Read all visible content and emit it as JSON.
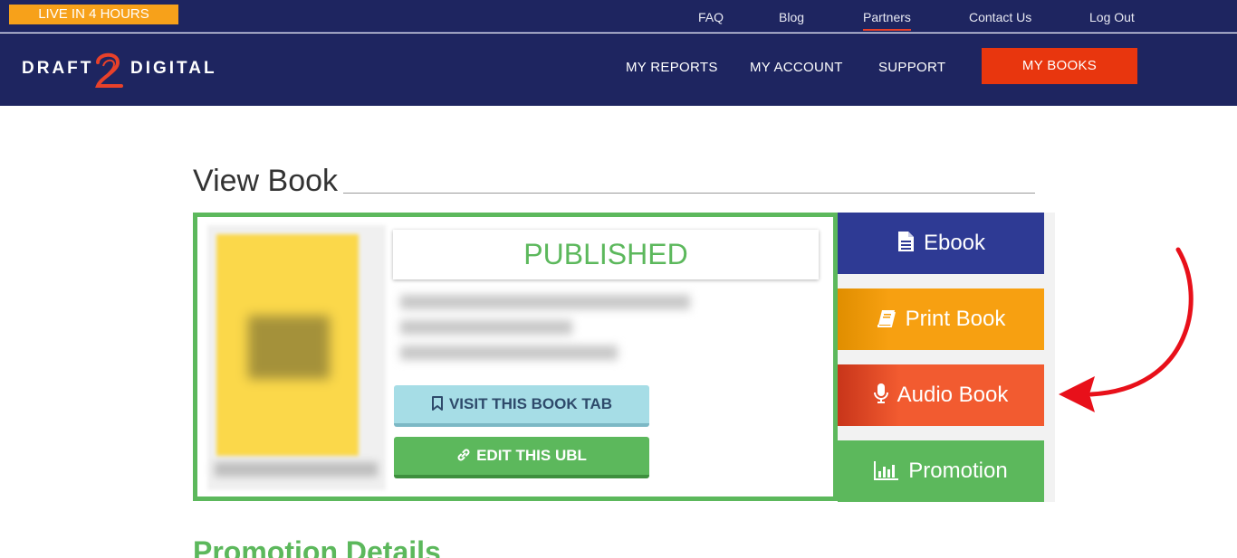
{
  "topbar": {
    "live_badge": "LIVE IN 4 HOURS",
    "links": [
      "FAQ",
      "Blog",
      "Partners",
      "Contact Us",
      "Log Out"
    ],
    "active_link": "Partners",
    "accent_color": "#e8412a"
  },
  "nav": {
    "logo": {
      "left": "DRAFT",
      "right": "DIGITAL",
      "numeral": "2"
    },
    "links": [
      "MY REPORTS",
      "MY ACCOUNT",
      "SUPPORT"
    ],
    "cta_label": "MY BOOKS",
    "cta_color": "#e8360e",
    "background": "#1e2560"
  },
  "page": {
    "title": "View Book",
    "section_heading": "Promotion Details"
  },
  "book": {
    "status": "PUBLISHED",
    "status_color": "#5cb85c",
    "cover_color": "#fbd84a",
    "visit_button": "VISIT THIS BOOK TAB",
    "edit_button": "EDIT THIS UBL",
    "visit_icon": "bookmark-icon",
    "edit_icon": "link-icon"
  },
  "format_tabs": [
    {
      "label": "Ebook",
      "icon": "document-icon",
      "color": "#2e3a94"
    },
    {
      "label": "Print Book",
      "icon": "book-icon",
      "color": "#f7a011"
    },
    {
      "label": "Audio Book",
      "icon": "microphone-icon",
      "color": "#f25b30"
    },
    {
      "label": "Promotion",
      "icon": "bar-chart-icon",
      "color": "#5cb85c"
    }
  ],
  "annotation": {
    "icon": "curved-arrow-icon",
    "color": "#e8101a"
  }
}
